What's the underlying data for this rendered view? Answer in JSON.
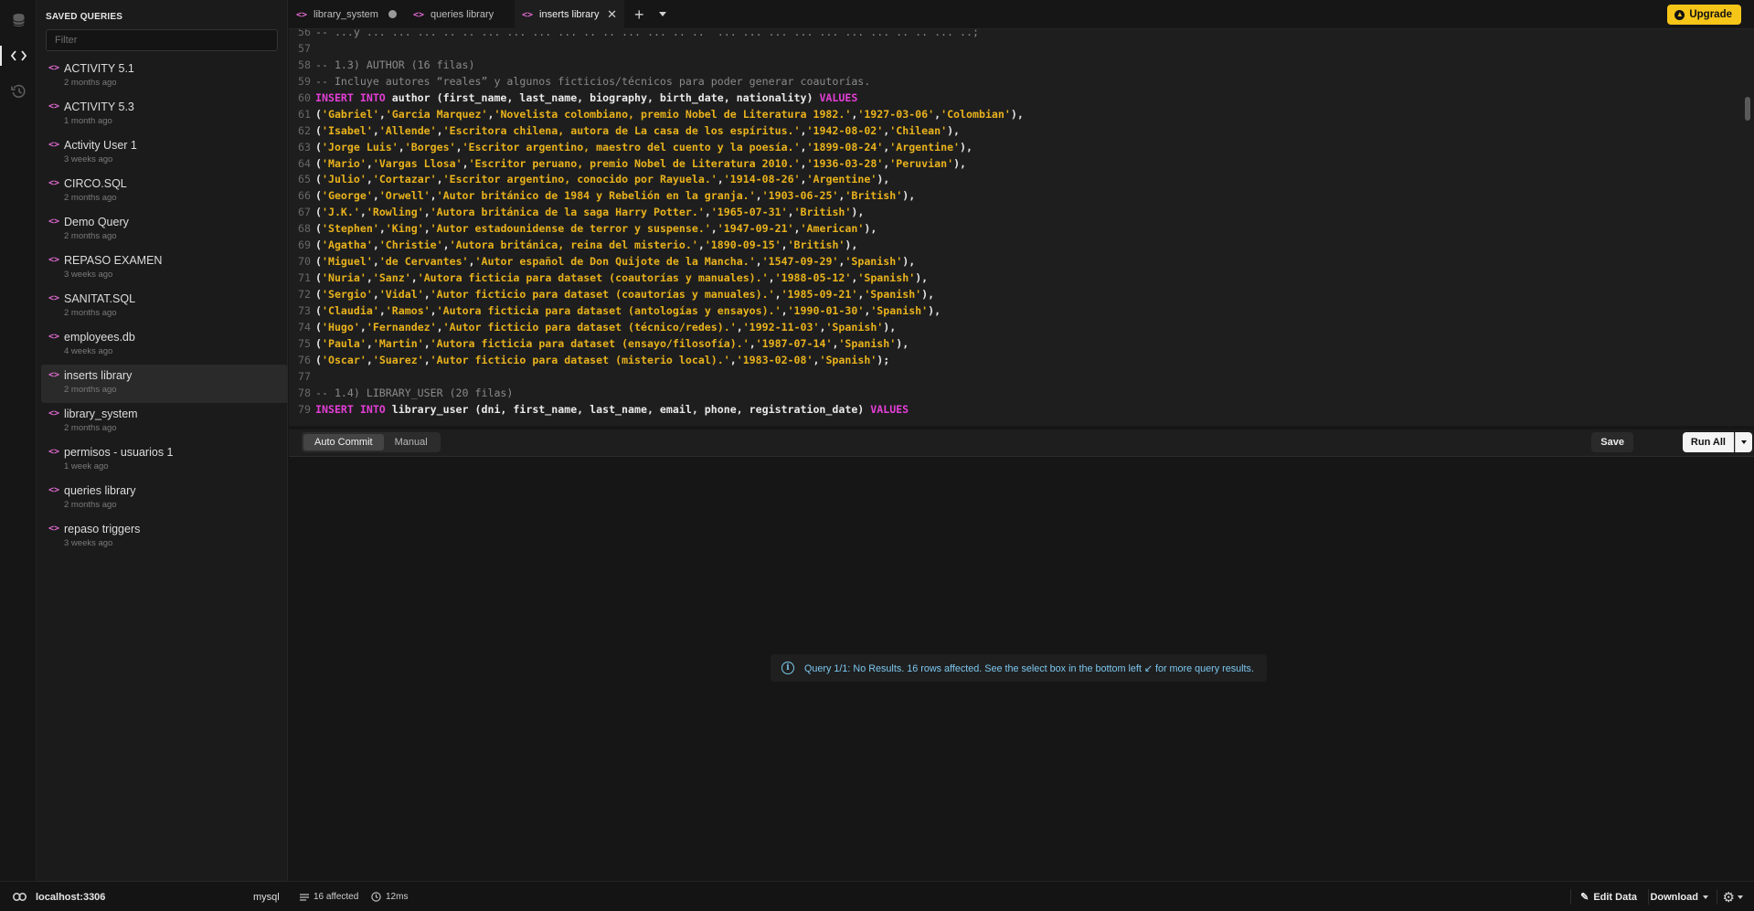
{
  "rail": {
    "database_icon": "database-icon",
    "code_icon": "code-icon",
    "history_icon": "history-icon"
  },
  "sidebar": {
    "title": "SAVED QUERIES",
    "filter_placeholder": "Filter",
    "items": [
      {
        "name": "ACTIVITY 5.1",
        "time": "2 months ago"
      },
      {
        "name": "ACTIVITY 5.3",
        "time": "1 month ago"
      },
      {
        "name": "Activity User 1",
        "time": "3 weeks ago"
      },
      {
        "name": "CIRCO.SQL",
        "time": "2 months ago"
      },
      {
        "name": "Demo Query",
        "time": "2 months ago"
      },
      {
        "name": "REPASO EXAMEN",
        "time": "3 weeks ago"
      },
      {
        "name": "SANITAT.SQL",
        "time": "2 months ago"
      },
      {
        "name": "employees.db",
        "time": "4 weeks ago"
      },
      {
        "name": "inserts library",
        "time": "2 months ago",
        "active": true
      },
      {
        "name": "library_system",
        "time": "2 months ago"
      },
      {
        "name": "permisos - usuarios 1",
        "time": "1 week ago"
      },
      {
        "name": "queries library",
        "time": "2 months ago"
      },
      {
        "name": "repaso triggers",
        "time": "3 weeks ago"
      }
    ]
  },
  "tabs": [
    {
      "label": "library_system",
      "state": "unsaved"
    },
    {
      "label": "queries library",
      "state": "normal"
    },
    {
      "label": "inserts library",
      "state": "active"
    }
  ],
  "upgrade_label": "Upgrade",
  "editor": {
    "lines": [
      {
        "n": "56",
        "t": [
          [
            "cm",
            "-- ...y ... ... ... .. .. ... ... ... ... .. .. ... ... .. ..  ... ... ... ... ... ... ... .. .. ... ..;"
          ]
        ]
      },
      {
        "n": "57",
        "t": []
      },
      {
        "n": "58",
        "t": [
          [
            "cm",
            "-- 1.3) AUTHOR (16 filas)"
          ]
        ]
      },
      {
        "n": "59",
        "t": [
          [
            "cm",
            "-- Incluye autores “reales” y algunos ficticios/técnicos para poder generar coautorías."
          ]
        ]
      },
      {
        "n": "60",
        "t": [
          [
            "kw",
            "INSERT INTO"
          ],
          [
            "id",
            " author (first_name, last_name, biography, birth_date, nationality) "
          ],
          [
            "kw",
            "VALUES"
          ]
        ]
      },
      {
        "n": "61",
        "t": [
          [
            "pn",
            "("
          ],
          [
            "st",
            "'Gabriel'"
          ],
          [
            "pn",
            ","
          ],
          [
            "st",
            "'Garcia Marquez'"
          ],
          [
            "pn",
            ","
          ],
          [
            "st",
            "'Novelista colombiano, premio Nobel de Literatura 1982.'"
          ],
          [
            "pn",
            ","
          ],
          [
            "st",
            "'1927-03-06'"
          ],
          [
            "pn",
            ","
          ],
          [
            "st",
            "'Colombian'"
          ],
          [
            "pn",
            "),"
          ]
        ]
      },
      {
        "n": "62",
        "t": [
          [
            "pn",
            "("
          ],
          [
            "st",
            "'Isabel'"
          ],
          [
            "pn",
            ","
          ],
          [
            "st",
            "'Allende'"
          ],
          [
            "pn",
            ","
          ],
          [
            "st",
            "'Escritora chilena, autora de La casa de los espíritus.'"
          ],
          [
            "pn",
            ","
          ],
          [
            "st",
            "'1942-08-02'"
          ],
          [
            "pn",
            ","
          ],
          [
            "st",
            "'Chilean'"
          ],
          [
            "pn",
            "),"
          ]
        ]
      },
      {
        "n": "63",
        "t": [
          [
            "pn",
            "("
          ],
          [
            "st",
            "'Jorge Luis'"
          ],
          [
            "pn",
            ","
          ],
          [
            "st",
            "'Borges'"
          ],
          [
            "pn",
            ","
          ],
          [
            "st",
            "'Escritor argentino, maestro del cuento y la poesía.'"
          ],
          [
            "pn",
            ","
          ],
          [
            "st",
            "'1899-08-24'"
          ],
          [
            "pn",
            ","
          ],
          [
            "st",
            "'Argentine'"
          ],
          [
            "pn",
            "),"
          ]
        ]
      },
      {
        "n": "64",
        "t": [
          [
            "pn",
            "("
          ],
          [
            "st",
            "'Mario'"
          ],
          [
            "pn",
            ","
          ],
          [
            "st",
            "'Vargas Llosa'"
          ],
          [
            "pn",
            ","
          ],
          [
            "st",
            "'Escritor peruano, premio Nobel de Literatura 2010.'"
          ],
          [
            "pn",
            ","
          ],
          [
            "st",
            "'1936-03-28'"
          ],
          [
            "pn",
            ","
          ],
          [
            "st",
            "'Peruvian'"
          ],
          [
            "pn",
            "),"
          ]
        ]
      },
      {
        "n": "65",
        "t": [
          [
            "pn",
            "("
          ],
          [
            "st",
            "'Julio'"
          ],
          [
            "pn",
            ","
          ],
          [
            "st",
            "'Cortazar'"
          ],
          [
            "pn",
            ","
          ],
          [
            "st",
            "'Escritor argentino, conocido por Rayuela.'"
          ],
          [
            "pn",
            ","
          ],
          [
            "st",
            "'1914-08-26'"
          ],
          [
            "pn",
            ","
          ],
          [
            "st",
            "'Argentine'"
          ],
          [
            "pn",
            "),"
          ]
        ]
      },
      {
        "n": "66",
        "t": [
          [
            "pn",
            "("
          ],
          [
            "st",
            "'George'"
          ],
          [
            "pn",
            ","
          ],
          [
            "st",
            "'Orwell'"
          ],
          [
            "pn",
            ","
          ],
          [
            "st",
            "'Autor británico de 1984 y Rebelión en la granja.'"
          ],
          [
            "pn",
            ","
          ],
          [
            "st",
            "'1903-06-25'"
          ],
          [
            "pn",
            ","
          ],
          [
            "st",
            "'British'"
          ],
          [
            "pn",
            "),"
          ]
        ]
      },
      {
        "n": "67",
        "t": [
          [
            "pn",
            "("
          ],
          [
            "st",
            "'J.K.'"
          ],
          [
            "pn",
            ","
          ],
          [
            "st",
            "'Rowling'"
          ],
          [
            "pn",
            ","
          ],
          [
            "st",
            "'Autora británica de la saga Harry Potter.'"
          ],
          [
            "pn",
            ","
          ],
          [
            "st",
            "'1965-07-31'"
          ],
          [
            "pn",
            ","
          ],
          [
            "st",
            "'British'"
          ],
          [
            "pn",
            "),"
          ]
        ]
      },
      {
        "n": "68",
        "t": [
          [
            "pn",
            "("
          ],
          [
            "st",
            "'Stephen'"
          ],
          [
            "pn",
            ","
          ],
          [
            "st",
            "'King'"
          ],
          [
            "pn",
            ","
          ],
          [
            "st",
            "'Autor estadounidense de terror y suspense.'"
          ],
          [
            "pn",
            ","
          ],
          [
            "st",
            "'1947-09-21'"
          ],
          [
            "pn",
            ","
          ],
          [
            "st",
            "'American'"
          ],
          [
            "pn",
            "),"
          ]
        ]
      },
      {
        "n": "69",
        "t": [
          [
            "pn",
            "("
          ],
          [
            "st",
            "'Agatha'"
          ],
          [
            "pn",
            ","
          ],
          [
            "st",
            "'Christie'"
          ],
          [
            "pn",
            ","
          ],
          [
            "st",
            "'Autora británica, reina del misterio.'"
          ],
          [
            "pn",
            ","
          ],
          [
            "st",
            "'1890-09-15'"
          ],
          [
            "pn",
            ","
          ],
          [
            "st",
            "'British'"
          ],
          [
            "pn",
            "),"
          ]
        ]
      },
      {
        "n": "70",
        "t": [
          [
            "pn",
            "("
          ],
          [
            "st",
            "'Miguel'"
          ],
          [
            "pn",
            ","
          ],
          [
            "st",
            "'de Cervantes'"
          ],
          [
            "pn",
            ","
          ],
          [
            "st",
            "'Autor español de Don Quijote de la Mancha.'"
          ],
          [
            "pn",
            ","
          ],
          [
            "st",
            "'1547-09-29'"
          ],
          [
            "pn",
            ","
          ],
          [
            "st",
            "'Spanish'"
          ],
          [
            "pn",
            "),"
          ]
        ]
      },
      {
        "n": "71",
        "t": [
          [
            "pn",
            "("
          ],
          [
            "st",
            "'Nuria'"
          ],
          [
            "pn",
            ","
          ],
          [
            "st",
            "'Sanz'"
          ],
          [
            "pn",
            ","
          ],
          [
            "st",
            "'Autora ficticia para dataset (coautorías y manuales).'"
          ],
          [
            "pn",
            ","
          ],
          [
            "st",
            "'1988-05-12'"
          ],
          [
            "pn",
            ","
          ],
          [
            "st",
            "'Spanish'"
          ],
          [
            "pn",
            "),"
          ]
        ]
      },
      {
        "n": "72",
        "t": [
          [
            "pn",
            "("
          ],
          [
            "st",
            "'Sergio'"
          ],
          [
            "pn",
            ","
          ],
          [
            "st",
            "'Vidal'"
          ],
          [
            "pn",
            ","
          ],
          [
            "st",
            "'Autor ficticio para dataset (coautorías y manuales).'"
          ],
          [
            "pn",
            ","
          ],
          [
            "st",
            "'1985-09-21'"
          ],
          [
            "pn",
            ","
          ],
          [
            "st",
            "'Spanish'"
          ],
          [
            "pn",
            "),"
          ]
        ]
      },
      {
        "n": "73",
        "t": [
          [
            "pn",
            "("
          ],
          [
            "st",
            "'Claudia'"
          ],
          [
            "pn",
            ","
          ],
          [
            "st",
            "'Ramos'"
          ],
          [
            "pn",
            ","
          ],
          [
            "st",
            "'Autora ficticia para dataset (antologías y ensayos).'"
          ],
          [
            "pn",
            ","
          ],
          [
            "st",
            "'1990-01-30'"
          ],
          [
            "pn",
            ","
          ],
          [
            "st",
            "'Spanish'"
          ],
          [
            "pn",
            "),"
          ]
        ]
      },
      {
        "n": "74",
        "t": [
          [
            "pn",
            "("
          ],
          [
            "st",
            "'Hugo'"
          ],
          [
            "pn",
            ","
          ],
          [
            "st",
            "'Fernandez'"
          ],
          [
            "pn",
            ","
          ],
          [
            "st",
            "'Autor ficticio para dataset (técnico/redes).'"
          ],
          [
            "pn",
            ","
          ],
          [
            "st",
            "'1992-11-03'"
          ],
          [
            "pn",
            ","
          ],
          [
            "st",
            "'Spanish'"
          ],
          [
            "pn",
            "),"
          ]
        ]
      },
      {
        "n": "75",
        "t": [
          [
            "pn",
            "("
          ],
          [
            "st",
            "'Paula'"
          ],
          [
            "pn",
            ","
          ],
          [
            "st",
            "'Martin'"
          ],
          [
            "pn",
            ","
          ],
          [
            "st",
            "'Autora ficticia para dataset (ensayo/filosofía).'"
          ],
          [
            "pn",
            ","
          ],
          [
            "st",
            "'1987-07-14'"
          ],
          [
            "pn",
            ","
          ],
          [
            "st",
            "'Spanish'"
          ],
          [
            "pn",
            "),"
          ]
        ]
      },
      {
        "n": "76",
        "t": [
          [
            "pn",
            "("
          ],
          [
            "st",
            "'Oscar'"
          ],
          [
            "pn",
            ","
          ],
          [
            "st",
            "'Suarez'"
          ],
          [
            "pn",
            ","
          ],
          [
            "st",
            "'Autor ficticio para dataset (misterio local).'"
          ],
          [
            "pn",
            ","
          ],
          [
            "st",
            "'1983-02-08'"
          ],
          [
            "pn",
            ","
          ],
          [
            "st",
            "'Spanish'"
          ],
          [
            "pn",
            ");"
          ]
        ]
      },
      {
        "n": "77",
        "t": []
      },
      {
        "n": "78",
        "t": [
          [
            "cm",
            "-- 1.4) LIBRARY_USER (20 filas)"
          ]
        ]
      },
      {
        "n": "79",
        "t": [
          [
            "kw",
            "INSERT INTO"
          ],
          [
            "id",
            " library_user (dni, first_name, last_name, email, phone, registration_date) "
          ],
          [
            "kw",
            "VALUES"
          ]
        ]
      }
    ]
  },
  "toolbar": {
    "commit_modes": [
      "Auto Commit",
      "Manual"
    ],
    "commit_selected": "Auto Commit",
    "save_label": "Save",
    "run_label": "Run All"
  },
  "result": {
    "message": "Query 1/1: No Results. 16 rows affected. See the select box in the bottom left ↙ for more query results."
  },
  "status": {
    "host": "localhost:3306",
    "db_type": "mysql",
    "affected": "16 affected",
    "time": "12ms",
    "edit_data": "Edit Data",
    "download": "Download"
  },
  "colors": {
    "accent": "#f5c518",
    "keyword": "#e33fd6",
    "string": "#e9b21c",
    "info": "#7cc7ef"
  }
}
